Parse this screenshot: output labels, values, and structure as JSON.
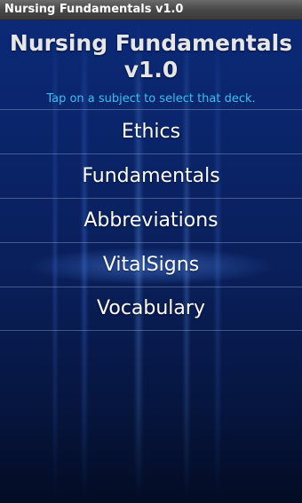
{
  "app": {
    "window_title": "Nursing Fundamentals v1.0"
  },
  "header": {
    "title_line1": "Nursing Fundamentals",
    "title_line2": "v1.0",
    "subtitle": "Tap on a subject to select that deck."
  },
  "decks": [
    {
      "label": "Ethics"
    },
    {
      "label": "Fundamentals"
    },
    {
      "label": "Abbreviations"
    },
    {
      "label": "VitalSigns"
    },
    {
      "label": "Vocabulary"
    }
  ],
  "colors": {
    "background": "#0a2468",
    "subtitle": "#38c0ec",
    "title": "#e6e6e6",
    "titlebar": "#4a4a4a"
  }
}
